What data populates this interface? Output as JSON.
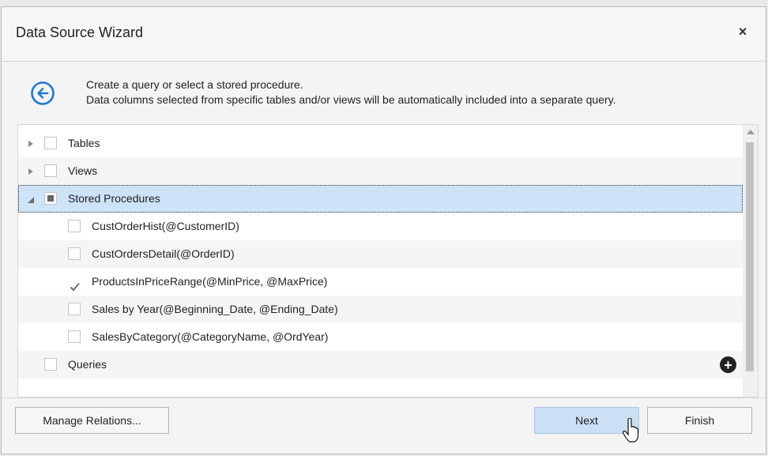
{
  "window": {
    "title": "Data Source Wizard",
    "close_label": "×"
  },
  "header": {
    "line1": "Create a query or select a stored procedure.",
    "line2": "Data columns selected from specific tables and/or views will be automatically included into a separate query."
  },
  "tree": {
    "items": [
      {
        "label": "Tables",
        "expanded": false,
        "checked": "unchecked"
      },
      {
        "label": "Views",
        "expanded": false,
        "checked": "unchecked"
      },
      {
        "label": "Stored Procedures",
        "expanded": true,
        "checked": "indeterminate",
        "selected": true
      },
      {
        "label": "CustOrderHist(@CustomerID)",
        "checked": "unchecked"
      },
      {
        "label": "CustOrdersDetail(@OrderID)",
        "checked": "unchecked"
      },
      {
        "label": "ProductsInPriceRange(@MinPrice, @MaxPrice)",
        "checked": "checked"
      },
      {
        "label": "Sales by Year(@Beginning_Date, @Ending_Date)",
        "checked": "unchecked"
      },
      {
        "label": "SalesByCategory(@CategoryName, @OrdYear)",
        "checked": "unchecked"
      },
      {
        "label": "Queries",
        "checked": "unchecked"
      }
    ]
  },
  "footer": {
    "manage_relations": "Manage Relations...",
    "next": "Next",
    "finish": "Finish"
  },
  "colors": {
    "selection": "#cde3f7",
    "primary_button": "#cce0f5",
    "accent": "#1e78d4"
  }
}
